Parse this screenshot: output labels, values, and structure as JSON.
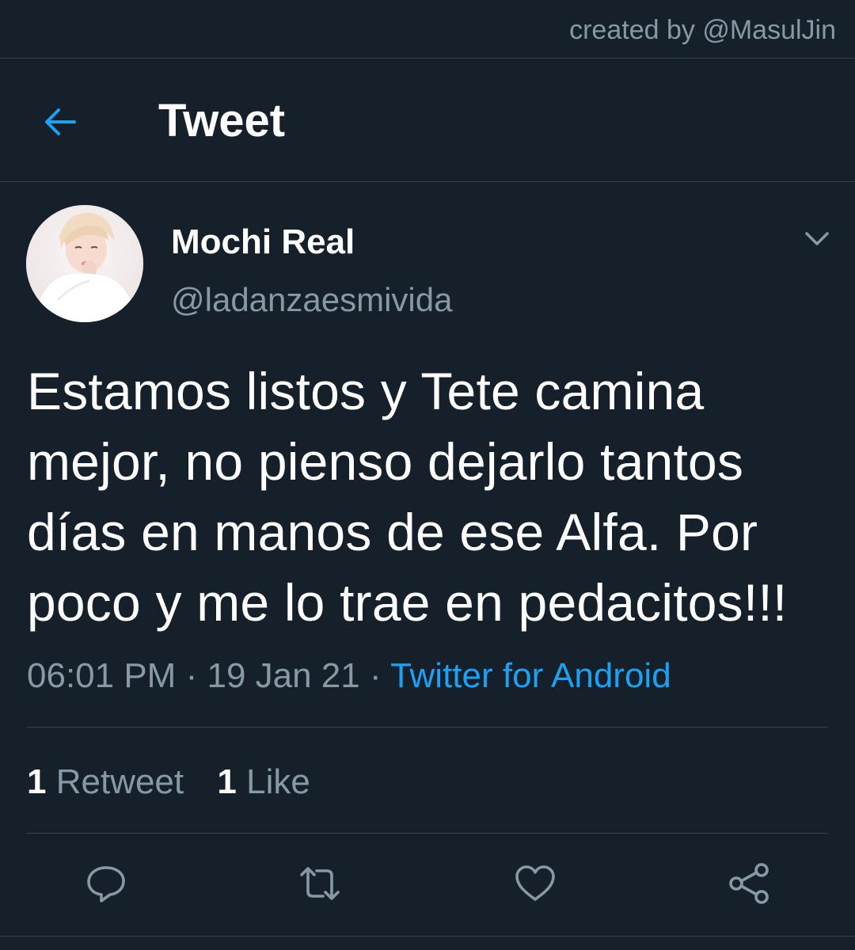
{
  "credit": {
    "text": "created by @MasulJin"
  },
  "header": {
    "back_icon": "arrow-left-icon",
    "title": "Tweet"
  },
  "tweet": {
    "author": {
      "display_name": "Mochi Real",
      "handle": "@ladanzaesmivida",
      "avatar": "avatar"
    },
    "text": "Estamos listos y Tete camina mejor, no pienso dejarlo tantos días en manos de ese Alfa. Por poco y me lo trae en pedacitos!!!",
    "time": "06:01 PM",
    "date": "19 Jan 21",
    "separator": "·",
    "source": "Twitter for Android",
    "stats": {
      "retweets_count": "1",
      "retweets_label": "Retweet",
      "likes_count": "1",
      "likes_label": "Like"
    }
  },
  "actions": [
    {
      "name": "reply",
      "icon": "reply-icon"
    },
    {
      "name": "retweet",
      "icon": "retweet-icon"
    },
    {
      "name": "like",
      "icon": "heart-icon"
    },
    {
      "name": "share",
      "icon": "share-icon"
    }
  ],
  "colors": {
    "background": "#15202b",
    "divider": "#38444d",
    "secondary_text": "#8899a6",
    "accent": "#1da1f2",
    "primary_text": "#ffffff"
  }
}
